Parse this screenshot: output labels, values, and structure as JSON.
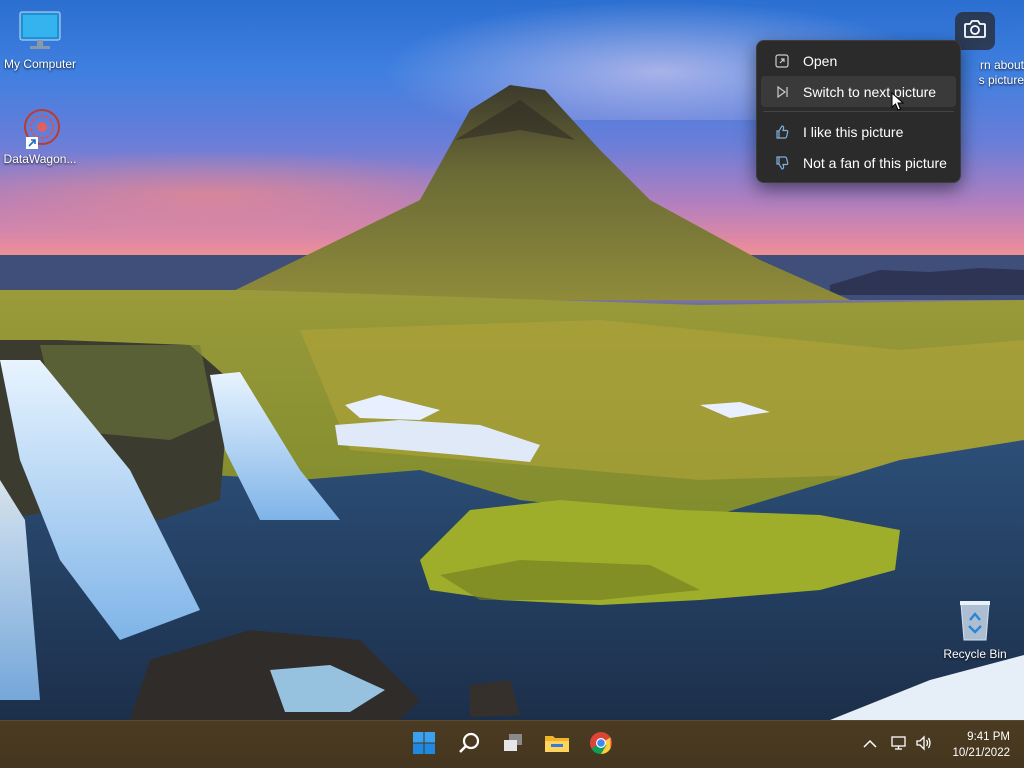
{
  "desktop": {
    "icons": [
      {
        "label": "My Computer",
        "icon": "monitor-icon"
      },
      {
        "label": "DataWagon...",
        "icon": "datawagon-shortcut-icon"
      }
    ],
    "recycle_bin": {
      "label": "Recycle Bin",
      "icon": "recycle-bin-icon"
    }
  },
  "spotlight": {
    "camera_icon": "camera-icon",
    "learn_label_line1": "rn about",
    "learn_label_line2": "s picture"
  },
  "context_menu": {
    "items": [
      {
        "label": "Open",
        "icon": "open-icon"
      },
      {
        "label": "Switch to next picture",
        "icon": "next-picture-icon"
      },
      {
        "label": "I like this picture",
        "icon": "thumbs-up-icon"
      },
      {
        "label": "Not a fan of this picture",
        "icon": "thumbs-down-icon"
      }
    ],
    "hovered_item": "Switch to next picture"
  },
  "taskbar": {
    "apps": [
      "start-icon",
      "search-icon",
      "task-view-icon",
      "file-explorer-icon",
      "chrome-icon"
    ],
    "tray": [
      "chevron-up-icon",
      "network-icon",
      "volume-icon"
    ],
    "time": "9:41 PM",
    "date": "10/21/2022"
  },
  "colors": {
    "taskbar": "#4a3a22",
    "menu_bg": "#2b2b2b",
    "accent": "#0078d4"
  }
}
